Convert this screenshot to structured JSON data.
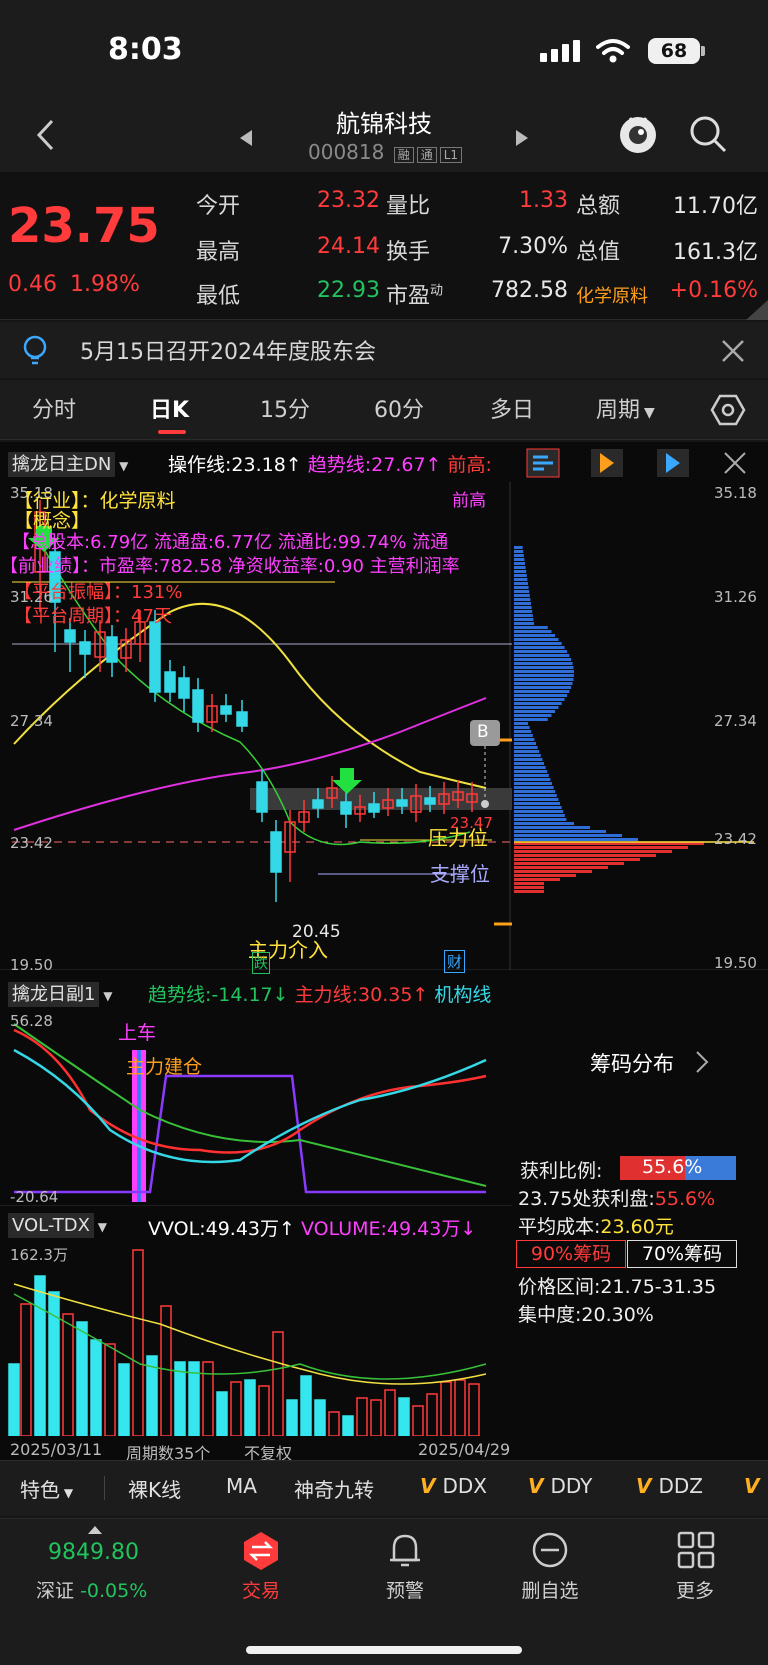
{
  "status_bar": {
    "time": "8:03",
    "battery": "68"
  },
  "header": {
    "name": "航锦科技",
    "code": "000818",
    "tags": [
      "融",
      "通",
      "L1"
    ]
  },
  "quote": {
    "price": "23.75",
    "change": "0.46",
    "change_pct": "1.98%",
    "rows": [
      [
        {
          "label": "今开",
          "value": "23.32"
        },
        {
          "label": "量比",
          "value": "1.33"
        },
        {
          "label": "总额",
          "value": "11.70亿"
        }
      ],
      [
        {
          "label": "最高",
          "value": "24.14"
        },
        {
          "label": "换手",
          "value": "7.30%"
        },
        {
          "label": "总值",
          "value": "161.3亿"
        }
      ],
      [
        {
          "label": "最低",
          "value": "22.93"
        },
        {
          "label": "市盈",
          "sup": "动",
          "value": "782.58"
        },
        {
          "label": "化学原料",
          "value": "+0.16%"
        }
      ]
    ]
  },
  "notice": {
    "text": "5月15日召开2024年度股东会"
  },
  "tabs": [
    "分时",
    "日K",
    "15分",
    "60分",
    "多日",
    "周期"
  ],
  "main_chart": {
    "indicator": "擒龙日主DN",
    "lines": [
      {
        "text": "操作线:23.18↑",
        "color": "#ffffff"
      },
      {
        "text": "趋势线:27.67↑",
        "color": "#ff3fff"
      },
      {
        "text": "前高:",
        "color": "#ff3b3b"
      }
    ],
    "info_lines": [
      "【行业】：化学原料",
      "【概念】",
      "【总股本:6.79亿 流通盘:6.77亿 流通比:99.74% 流通",
      "【前业绩】：市盈率:782.58 净资收益率:0.90 主营利润率",
      "【平台振幅】：131%",
      "【平台周期】：47天"
    ],
    "label_front_high": "前高",
    "y_ticks": [
      "35.18",
      "31.26",
      "27.34",
      "23.42",
      "19.50"
    ],
    "pressure_label": "压力位",
    "support_label": "支撑位",
    "main_entry_label": "主力介入",
    "low_label": "20.45",
    "die_tag": "跌",
    "cai_tag": "财",
    "b_tag": "B",
    "last_label": "23.47"
  },
  "sub_chart": {
    "indicator": "擒龙日副1",
    "lines": [
      {
        "text": "趋势线:-14.17↓",
        "color": "#22c35e"
      },
      {
        "text": "主力线:30.35↑",
        "color": "#ff3b3b"
      },
      {
        "text": "机构线",
        "color": "#35d8e6"
      }
    ],
    "top_value": "56.28",
    "bottom_value": "-20.64",
    "label_board": "上车",
    "label_build": "主力建仓"
  },
  "volume_chart": {
    "indicator": "VOL-TDX",
    "lines": [
      {
        "text": "VVOL:49.43万↑",
        "color": "#ffffff"
      },
      {
        "text": "VOLUME:49.43万↓",
        "color": "#ff3fff"
      }
    ],
    "max_label": "162.3万",
    "date_start": "2025/03/11",
    "period_count": "周期数35个",
    "adjust": "不复权",
    "date_end": "2025/04/29"
  },
  "chip_panel": {
    "y_ticks": [
      "35.18",
      "31.26",
      "27.34",
      "23.42",
      "19.50"
    ],
    "title": "筹码分布",
    "profit_ratio_label": "获利比例:",
    "profit_ratio": "55.6%",
    "profit_at_label": "23.75处获利盘:",
    "profit_at": "55.6%",
    "avg_cost_label": "平均成本:",
    "avg_cost": "23.60元",
    "btn_90": "90%筹码",
    "btn_70": "70%筹码",
    "range_label": "价格区间:",
    "range": "21.75-31.35",
    "concentration_label": "集中度:",
    "concentration": "20.30%"
  },
  "tools": [
    "特色",
    "裸K线",
    "MA",
    "神奇九转",
    "DDX",
    "DDY",
    "DDZ"
  ],
  "bottom_nav": {
    "index_value": "9849.80",
    "index_name": "深证",
    "index_change": "-0.05%",
    "items": [
      "交易",
      "预警",
      "删自选",
      "更多"
    ]
  },
  "colors": {
    "up": "#ff3b3b",
    "down": "#35d8e6",
    "accent_green": "#22c35e",
    "bg": "#161616"
  }
}
